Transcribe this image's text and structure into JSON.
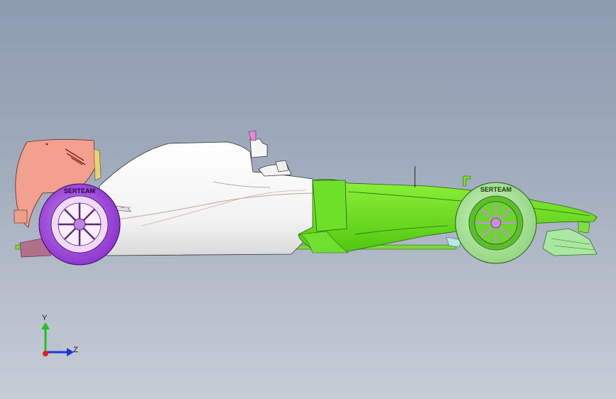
{
  "viewport": {
    "background_top": "#8d9bb0",
    "background_bottom": "#c5ccd6"
  },
  "model": {
    "rear_wing_color": "#f4a08f",
    "body_color": "#ffffff",
    "nose_color": "#7cf020",
    "rear_tyre_color": "#a64ee0",
    "front_tyre_color": "#a7e39a",
    "tyre_text_rear": "SERTEAM",
    "tyre_text_front": "SERTEAM"
  },
  "triad": {
    "y_label": "Y",
    "z_label": "Z",
    "y_color": "#22c022",
    "z_color": "#1f35d8",
    "x_color": "#e02020"
  }
}
